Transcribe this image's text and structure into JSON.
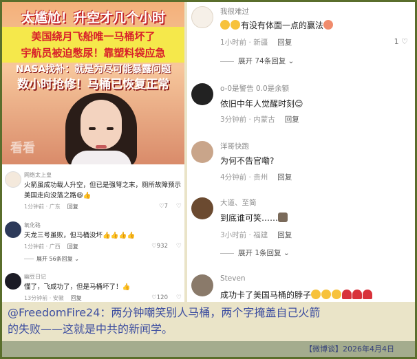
{
  "video": {
    "headline1": "太尴尬！升空才几个小时",
    "headline2a": "美国绕月飞船唯一马桶坏了",
    "headline2b": "宇航员被迫憋尿！靠塑料袋应急",
    "headline3": "NASA找补：就是为尽可能暴露问题",
    "headline4": "数小时抢修！马桶已恢复正常",
    "watermark": "看看"
  },
  "left_comments": [
    {
      "name": "网络太上皇",
      "text": "火箭虽成功载人升空，但已是强弩之末，厕所故障预示美国走向没落之路😆👍",
      "time": "1分钟前 · 广东",
      "reply": "回复",
      "likes": "7"
    },
    {
      "name": "氧化硌",
      "text": "天龙三号虽败，但马桶没坏👍👍👍👍",
      "time": "1分钟前 · 广西",
      "reply": "回复",
      "likes": "932",
      "expand": "展开 56条回复"
    },
    {
      "name": "幽豆日记",
      "text": "懂了，飞成功了，但是马桶坏了！👍",
      "time": "13分钟前 · 安徽",
      "reply": "回复",
      "likes": "120"
    }
  ],
  "right_comments": [
    {
      "name": "我很难过",
      "text": "有没有体面一点的赢法",
      "time": "1小时前 · 新疆",
      "reply": "回复",
      "likes": "1",
      "expand": "展开 74条回复"
    },
    {
      "name": "o-0是警告 0.0是余额",
      "text": "依旧中年人觉醒时刻😊",
      "time": "3分钟前 · 内蒙古",
      "reply": "回复"
    },
    {
      "name": "洋哥快跑",
      "text": "为何不告官嘞?",
      "time": "4分钟前 · 贵州",
      "reply": "回复"
    },
    {
      "name": "大道、至简",
      "text": "到底谁可笑……",
      "time": "3小时前 · 福建",
      "reply": "回复",
      "expand": "展开 1条回复"
    },
    {
      "name": "Steven",
      "text": "成功卡了美国马桶的脖子"
    }
  ],
  "caption": {
    "line1": "@FreedomFire24：两分钟嘲笑别人马桶，两个字掩盖自己火箭",
    "line2": "的失败——这就是中共的新闻学。",
    "footer": "【微博谈】2026年4月4日"
  }
}
